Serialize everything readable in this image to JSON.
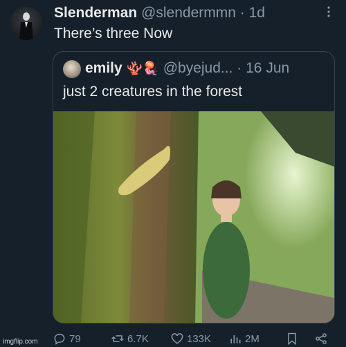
{
  "tweet": {
    "author_name": "Slenderman",
    "handle": "@slendermmn",
    "separator": "·",
    "time": "1d",
    "more_icon": "more-vertical-icon",
    "text": "There’s three Now"
  },
  "quoted_tweet": {
    "author_name": "emily",
    "emojis": "🪸🪼",
    "handle": "@byejud...",
    "separator": "·",
    "date": "16 Jun",
    "text": "just 2 creatures in the forest"
  },
  "actions": {
    "replies": "79",
    "retweets": "6.7K",
    "likes": "133K",
    "views": "2M"
  },
  "watermark": "imgflip.com",
  "colors": {
    "background": "#15202b",
    "text": "#e7e9ea",
    "muted": "#8b98a5",
    "border": "#38444d"
  }
}
